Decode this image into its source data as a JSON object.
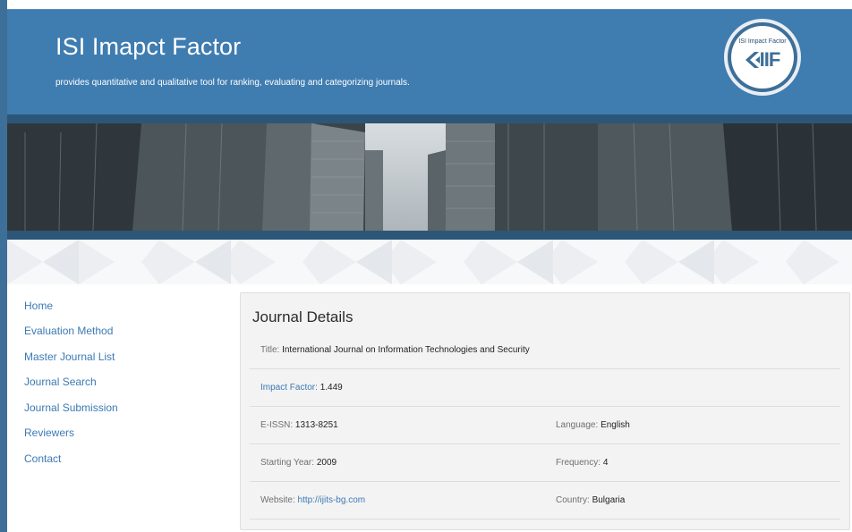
{
  "header": {
    "title": "ISI Imapct Factor",
    "tagline": "provides quantitative and qualitative tool for ranking, evaluating and categorizing journals.",
    "logo_caption": "ISI Impact Factor",
    "logo_mark": "IIF",
    "logo_icon": "chevron-logo-icon"
  },
  "colors": {
    "header_blue": "#3f7cb0",
    "dark_blue": "#2c5678",
    "link_blue": "#3c79b4",
    "panel_bg": "#f3f3f3"
  },
  "sidebar": {
    "items": [
      {
        "label": "Home"
      },
      {
        "label": "Evaluation Method"
      },
      {
        "label": "Master Journal List"
      },
      {
        "label": "Journal Search"
      },
      {
        "label": "Journal Submission"
      },
      {
        "label": "Reviewers"
      },
      {
        "label": "Contact"
      }
    ]
  },
  "journal": {
    "heading": "Journal Details",
    "title_label": "Title:",
    "title_value": "International Journal on Information Technologies and Security",
    "impact_label": "Impact Factor:",
    "impact_value": "1.449",
    "eissn_label": "E-ISSN:",
    "eissn_value": "1313-8251",
    "language_label": "Language:",
    "language_value": "English",
    "year_label": "Starting Year:",
    "year_value": "2009",
    "frequency_label": "Frequency:",
    "frequency_value": "4",
    "website_label": "Website:",
    "website_value": "http://ijits-bg.com",
    "country_label": "Country:",
    "country_value": "Bulgaria"
  }
}
